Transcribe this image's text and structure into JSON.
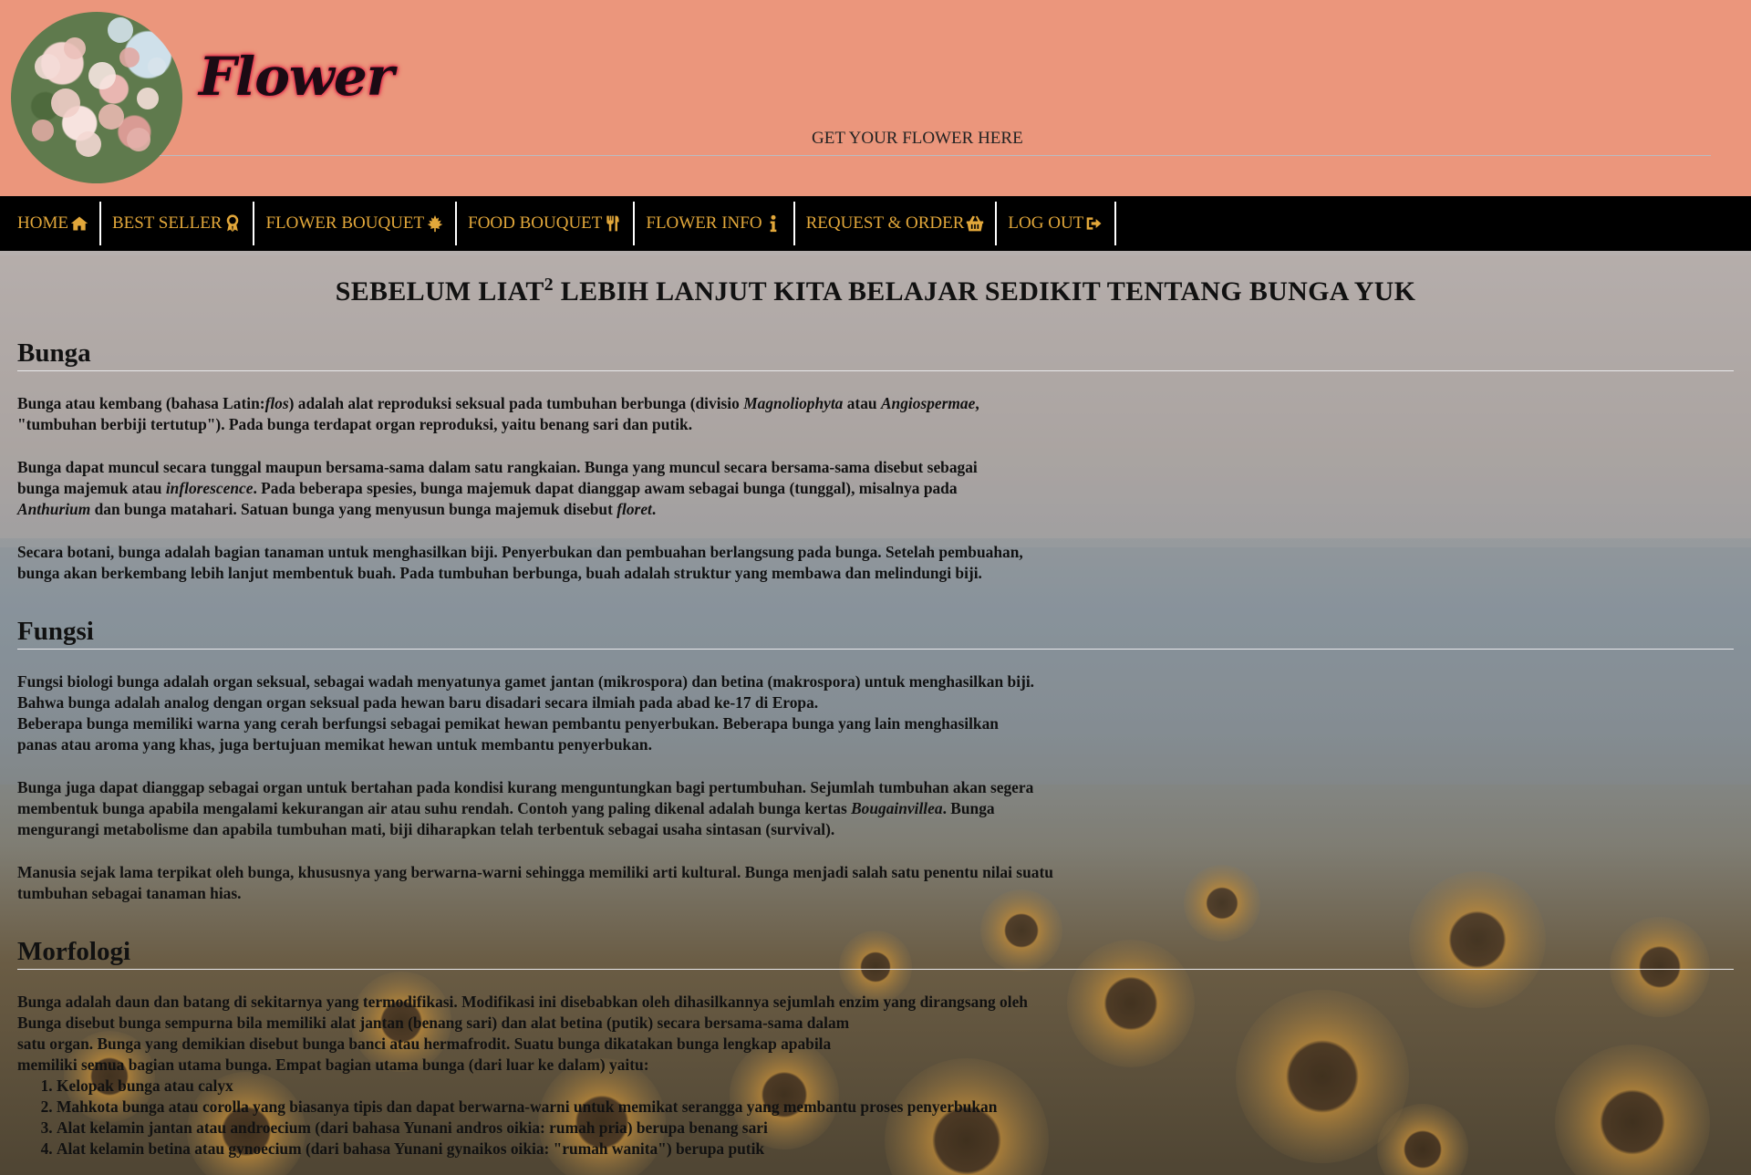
{
  "header": {
    "logo_alt": "flower-bush-logo",
    "brand": "Flower",
    "tagline": "GET YOUR FLOWER HERE"
  },
  "nav": {
    "items": [
      {
        "label": "HOME",
        "icon": "home-icon"
      },
      {
        "label": "BEST SELLER",
        "icon": "award-icon"
      },
      {
        "label": "FLOWER BOUQUET",
        "icon": "leaf-icon"
      },
      {
        "label": "FOOD BOUQUET",
        "icon": "utensils-icon"
      },
      {
        "label": "FLOWER INFO",
        "icon": "info-icon"
      },
      {
        "label": "REQUEST & ORDER",
        "icon": "basket-icon"
      },
      {
        "label": "LOG OUT",
        "icon": "sign-out-icon"
      }
    ]
  },
  "main": {
    "title_pre": "SEBELUM LIAT",
    "title_sup": "2",
    "title_post": " LEBIH LANJUT KITA BELAJAR SEDIKIT TENTANG BUNGA YUK"
  },
  "sections": {
    "bunga": {
      "heading": "Bunga",
      "p1a": "Bunga atau kembang (bahasa Latin:",
      "p1b": "flos",
      "p1c": ") adalah alat reproduksi seksual pada tumbuhan berbunga (divisio ",
      "p1d": "Magnoliophyta",
      "p1e": " atau ",
      "p1f": "Angiospermae",
      "p1g": ",",
      "p1h": "\"tumbuhan berbiji tertutup\"). Pada bunga terdapat organ reproduksi, yaitu benang sari dan putik.",
      "p2a": "Bunga dapat muncul secara tunggal maupun bersama-sama dalam satu rangkaian. Bunga yang muncul secara bersama-sama disebut sebagai",
      "p2b": "bunga majemuk atau ",
      "p2c": "inflorescence",
      "p2d": ". Pada beberapa spesies, bunga majemuk dapat dianggap awam sebagai bunga (tunggal), misalnya pada",
      "p2e": "Anthurium",
      "p2f": " dan bunga matahari. Satuan bunga yang menyusun bunga majemuk disebut ",
      "p2g": "floret",
      "p2h": ".",
      "p3a": "Secara botani, bunga adalah bagian tanaman untuk menghasilkan biji. Penyerbukan dan pembuahan berlangsung pada bunga. Setelah pembuahan,",
      "p3b": "bunga akan berkembang lebih lanjut membentuk buah. Pada tumbuhan berbunga, buah adalah struktur yang membawa dan melindungi biji."
    },
    "fungsi": {
      "heading": "Fungsi",
      "p1a": "Fungsi biologi bunga adalah organ seksual, sebagai wadah menyatunya gamet jantan (mikrospora) dan betina (makrospora) untuk menghasilkan biji.",
      "p1b": "Bahwa bunga adalah analog dengan organ seksual pada hewan baru disadari secara ilmiah pada abad ke-17 di Eropa.",
      "p1c": "Beberapa bunga memiliki warna yang cerah berfungsi sebagai pemikat hewan pembantu penyerbukan. Beberapa bunga yang lain menghasilkan",
      "p1d": "panas atau aroma yang khas, juga bertujuan memikat hewan untuk membantu penyerbukan.",
      "p2a": "Bunga juga dapat dianggap sebagai organ untuk bertahan pada kondisi kurang menguntungkan bagi pertumbuhan. Sejumlah tumbuhan akan segera",
      "p2b": "membentuk bunga apabila mengalami kekurangan air atau suhu rendah. Contoh yang paling dikenal adalah bunga kertas ",
      "p2c": "Bougainvillea",
      "p2d": ". Bunga",
      "p2e": "mengurangi metabolisme dan apabila tumbuhan mati, biji diharapkan telah terbentuk sebagai usaha sintasan (survival).",
      "p3a": "Manusia sejak lama terpikat oleh bunga, khususnya yang berwarna-warni sehingga memiliki arti kultural. Bunga menjadi salah satu penentu nilai suatu",
      "p3b": "tumbuhan sebagai tanaman hias."
    },
    "morfologi": {
      "heading": "Morfologi",
      "p1a": "Bunga adalah daun dan batang di sekitarnya yang termodifikasi. Modifikasi ini disebabkan oleh dihasilkannya sejumlah enzim yang dirangsang oleh",
      "p1b": "Bunga disebut bunga sempurna bila memiliki alat jantan (benang sari) dan alat betina (putik) secara bersama-sama dalam",
      "p1c": "satu organ. Bunga yang demikian disebut bunga banci atau hermafrodit. Suatu bunga dikatakan bunga lengkap apabila",
      "p1d": "memiliki semua bagian utama bunga. Empat bagian utama bunga (dari luar ke dalam) yaitu:",
      "list": [
        "Kelopak bunga atau calyx",
        "Mahkota bunga atau corolla yang biasanya tipis dan dapat berwarna-warni untuk memikat serangga yang membantu proses penyerbukan",
        "Alat kelamin jantan atau androecium (dari bahasa Yunani andros oikia: rumah pria) berupa benang sari",
        "Alat kelamin betina atau gynoecium (dari bahasa Yunani gynaikos oikia: \"rumah wanita\") berupa putik"
      ]
    }
  },
  "colors": {
    "header_bg": "#eb967c",
    "nav_bg": "#000000",
    "nav_text": "#e2a73a",
    "brand_glow": "#e0123e"
  }
}
